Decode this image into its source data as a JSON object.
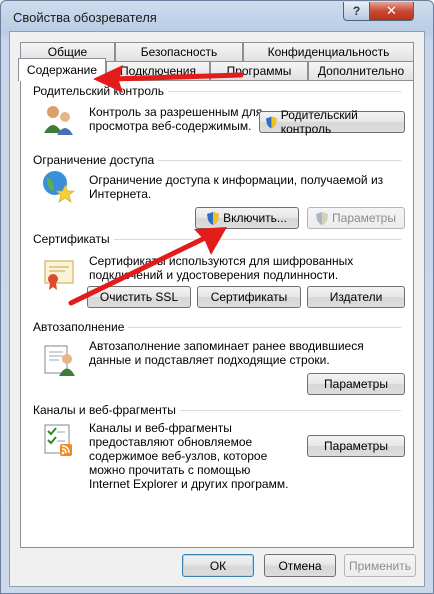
{
  "window": {
    "title": "Свойства обозревателя",
    "help_glyph": "?",
    "close_glyph": "✕"
  },
  "tabs": {
    "row1": [
      "Общие",
      "Безопасность",
      "Конфиденциальность"
    ],
    "row2": [
      "Содержание",
      "Подключения",
      "Программы",
      "Дополнительно"
    ],
    "active": "Содержание"
  },
  "parental": {
    "title": "Родительский контроль",
    "desc_line1": "Контроль за разрешенным для",
    "desc_line2": "просмотра веб-содержимым.",
    "button": "Родительский контроль"
  },
  "access": {
    "title": "Ограничение доступа",
    "desc_line1": "Ограничение доступа к информации, получаемой из",
    "desc_line2": "Интернета.",
    "enable_button": "Включить...",
    "params_button": "Параметры"
  },
  "certs": {
    "title": "Сертификаты",
    "desc_line1": "Сертификаты используются для шифрованных",
    "desc_line2": "подключений и удостоверения подлинности.",
    "clear_ssl": "Очистить SSL",
    "certificates": "Сертификаты",
    "publishers": "Издатели"
  },
  "autocomplete": {
    "title": "Автозаполнение",
    "desc_line1": "Автозаполнение запоминает ранее вводившиеся",
    "desc_line2": "данные и подставляет подходящие строки.",
    "params_button": "Параметры"
  },
  "feeds": {
    "title": "Каналы и веб-фрагменты",
    "desc_line1": "Каналы и веб-фрагменты",
    "desc_line2": "предоставляют обновляемое",
    "desc_line3": "содержимое веб-узлов, которое",
    "desc_line4": "можно прочитать с помощью",
    "desc_line5": "Internet Explorer и других программ.",
    "params_button": "Параметры"
  },
  "footer": {
    "ok": "ОК",
    "cancel": "Отмена",
    "apply": "Применить"
  },
  "colors": {
    "annotation_arrow": "#e21b1b",
    "tab_border": "#8a9098",
    "close_button": "#c74a34"
  }
}
